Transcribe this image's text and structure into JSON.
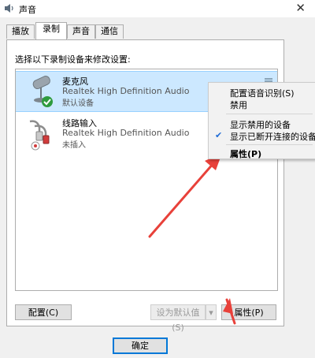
{
  "window": {
    "title": "声音"
  },
  "tabs": [
    "播放",
    "录制",
    "声音",
    "通信"
  ],
  "instruction": "选择以下录制设备来修改设置:",
  "devices": [
    {
      "name": "麦克风",
      "description": "Realtek High Definition Audio",
      "status": "默认设备"
    },
    {
      "name": "线路输入",
      "description": "Realtek High Definition Audio",
      "status": "未插入"
    }
  ],
  "buttons": {
    "configure": "配置(C)",
    "set_default": "设为默认值(S)",
    "properties": "属性(P)",
    "ok": "确定"
  },
  "context_menu": {
    "items": [
      "配置语音识别(S)",
      "禁用",
      "显示禁用的设备",
      "显示已断开连接的设备",
      "属性(P)"
    ]
  },
  "colors": {
    "selection": "#cce8ff",
    "annotation_arrow": "#e8413a",
    "check_mark": "#1e6bd6"
  }
}
